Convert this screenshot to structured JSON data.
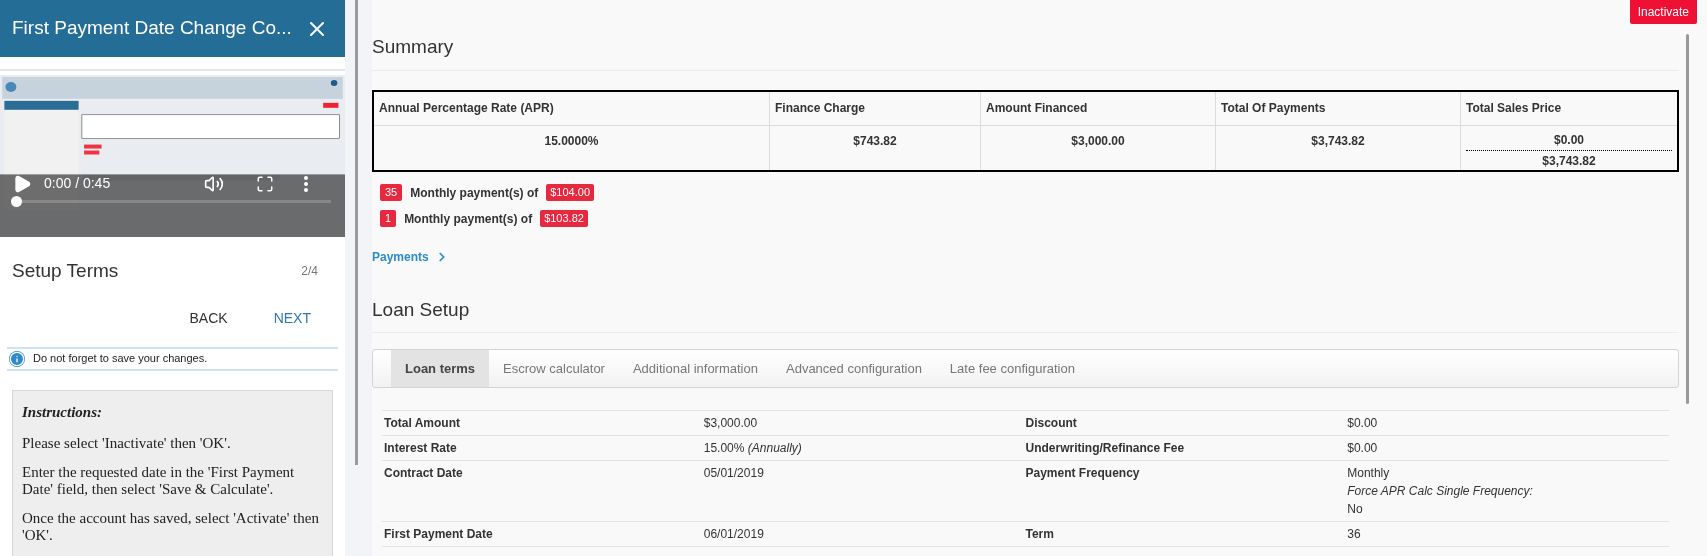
{
  "guide": {
    "title": "First Payment Date Change Co...",
    "video": {
      "time": "0:00 / 0:45",
      "level": 0
    },
    "step_title": "Setup Terms",
    "step_count": "2/4",
    "buttons": [
      {
        "label": "BACK",
        "primary": false
      },
      {
        "label": "NEXT",
        "primary": true
      }
    ],
    "notice": "Do not forget to save your changes.",
    "instructions": {
      "title": "Instructions:",
      "paragraphs": [
        "Please select 'Inactivate' then 'OK'.",
        "Enter the requested date in the 'First Payment Date' field, then select 'Save & Calculate'.",
        "Once the account has saved, select 'Activate' then 'OK'."
      ]
    }
  },
  "inactivate_button": "Inactivate",
  "summary": {
    "heading": "Summary",
    "columns": [
      {
        "header": "Annual Percentage Rate (APR)",
        "values": [
          "15.0000%"
        ]
      },
      {
        "header": "Finance Charge",
        "values": [
          "$743.82"
        ]
      },
      {
        "header": "Amount Financed",
        "values": [
          "$3,000.00"
        ]
      },
      {
        "header": "Total Of Payments",
        "values": [
          "$3,743.82"
        ]
      },
      {
        "header": "Total Sales Price",
        "values": [
          "$0.00",
          "$3,743.82"
        ]
      }
    ]
  },
  "payment_lines": [
    {
      "count": "35",
      "label": "Monthly payment(s) of",
      "amount": "$104.00"
    },
    {
      "count": "1",
      "label": "Monthly payment(s) of",
      "amount": "$103.82"
    }
  ],
  "payments_link": "Payments",
  "loan_setup": {
    "heading": "Loan Setup",
    "tabs": [
      {
        "label": "Loan terms",
        "selected": true
      },
      {
        "label": "Escrow calculator",
        "selected": false
      },
      {
        "label": "Additional information",
        "selected": false
      },
      {
        "label": "Advanced configuration",
        "selected": false
      },
      {
        "label": "Late fee configuration",
        "selected": false
      }
    ],
    "rows": [
      {
        "label": "Total Amount",
        "value": [
          "$3,000.00"
        ],
        "label_2": "Discount",
        "value_2": [
          "$0.00"
        ]
      },
      {
        "label": "Interest Rate",
        "value": [
          "15.00% *(Annually)*"
        ],
        "label_2": "Underwriting/Refinance Fee",
        "value_2": [
          "$0.00"
        ]
      },
      {
        "label": "Contract Date",
        "value": [
          "05/01/2019"
        ],
        "label_2": "Payment Frequency",
        "value_2": [
          "Monthly",
          "*Force APR Calc Single Frequency:*",
          "No"
        ]
      },
      {
        "label": "First Payment Date",
        "value": [
          "06/01/2019"
        ],
        "label_2": "Term",
        "value_2": [
          "36"
        ]
      }
    ]
  }
}
